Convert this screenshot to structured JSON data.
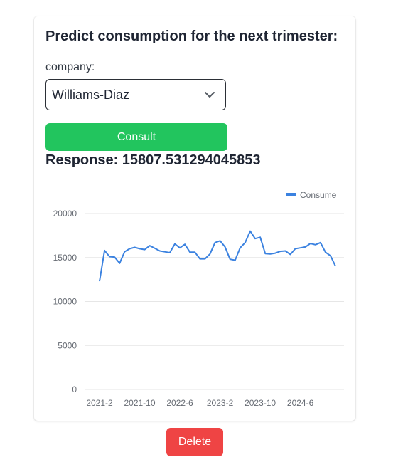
{
  "form": {
    "title": "Predict consumption for the next trimester:",
    "company_label": "company:",
    "company_value": "Williams-Diaz",
    "consult_label": "Consult",
    "response_text": "Response: 15807.531294045853"
  },
  "actions": {
    "delete_label": "Delete"
  },
  "colors": {
    "consult": "#22c55e",
    "delete": "#ef4444",
    "line": "#3b82e0"
  },
  "chart_data": {
    "type": "line",
    "x": [
      "2021-2",
      "2021-3",
      "2021-4",
      "2021-5",
      "2021-6",
      "2021-7",
      "2021-8",
      "2021-9",
      "2021-10",
      "2021-11",
      "2021-12",
      "2022-1",
      "2022-2",
      "2022-3",
      "2022-4",
      "2022-5",
      "2022-6",
      "2022-7",
      "2022-8",
      "2022-9",
      "2022-10",
      "2022-11",
      "2022-12",
      "2023-1",
      "2023-2",
      "2023-3",
      "2023-4",
      "2023-5",
      "2023-6",
      "2023-7",
      "2023-8",
      "2023-9",
      "2023-10",
      "2023-11",
      "2023-12",
      "2024-1",
      "2024-2",
      "2024-3",
      "2024-4",
      "2024-5",
      "2024-6",
      "2024-7",
      "2024-8",
      "2024-9",
      "2024-10",
      "2024-11",
      "2024-12"
    ],
    "series": [
      {
        "name": "Consume",
        "values": [
          12300,
          15800,
          15100,
          15050,
          14350,
          15650,
          16000,
          16150,
          16000,
          15900,
          16350,
          16050,
          15750,
          15650,
          15550,
          16550,
          16100,
          16500,
          15600,
          15600,
          14850,
          14850,
          15400,
          16700,
          16900,
          16200,
          14800,
          14700,
          16100,
          16700,
          18000,
          17150,
          17300,
          15450,
          15400,
          15500,
          15700,
          15750,
          15350,
          16000,
          16100,
          16200,
          16600,
          16450,
          16700,
          15600,
          15200,
          14000
        ]
      }
    ],
    "x_ticks": [
      "2021-2",
      "2021-10",
      "2022-6",
      "2023-2",
      "2023-10",
      "2024-6"
    ],
    "y_ticks": [
      0,
      5000,
      10000,
      15000,
      20000
    ],
    "ylim": [
      0,
      20000
    ],
    "legend": "top-right",
    "grid": "horizontal"
  }
}
